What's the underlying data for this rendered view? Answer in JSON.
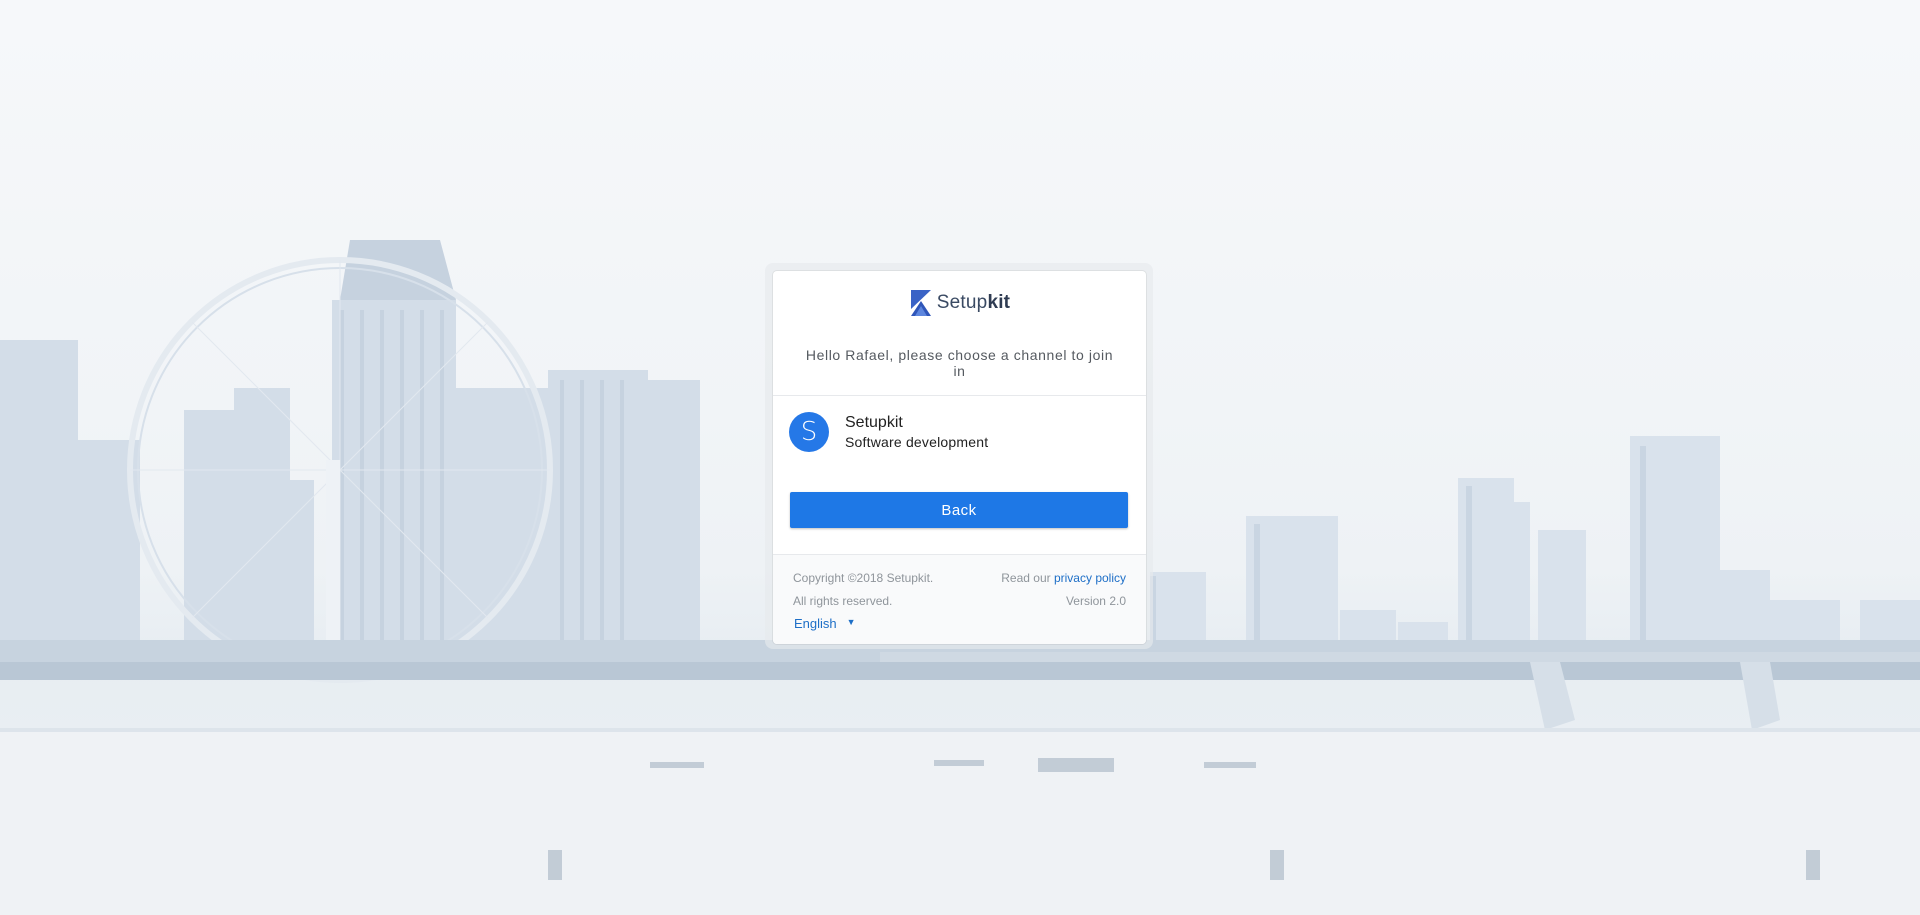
{
  "brand": {
    "name_regular": "Setup",
    "name_bold": "kit",
    "logo_icon": "setupkit-logo-icon",
    "accent_color": "#2578e7"
  },
  "greeting": "Hello Rafael, please choose a channel to join in",
  "channels": [
    {
      "initial": "S",
      "name": "Setupkit",
      "description": "Software development"
    }
  ],
  "back_button": {
    "label": "Back"
  },
  "footer": {
    "copyright": "Copyright ©2018 Setupkit.",
    "rights": "All rights reserved.",
    "read_our": "Read our",
    "privacy_link": "privacy policy",
    "version": "Version 2.0",
    "language": "English",
    "language_icon": "caret-down-icon"
  }
}
